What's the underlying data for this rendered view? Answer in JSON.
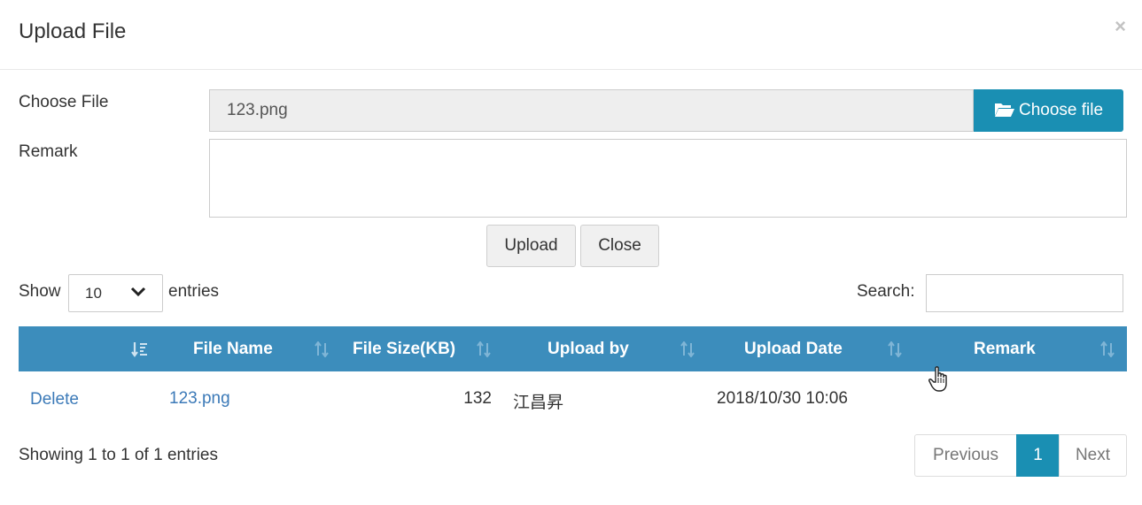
{
  "modal": {
    "title": "Upload File",
    "close_symbol": "×"
  },
  "form": {
    "choose_file_label": "Choose File",
    "file_name": "123.png",
    "choose_button": "Choose file",
    "remark_label": "Remark",
    "remark_value": "",
    "upload_button": "Upload",
    "close_button": "Close"
  },
  "table_controls": {
    "show_label": "Show",
    "entries_value": "10",
    "entries_label": "entries",
    "search_label": "Search:",
    "search_value": ""
  },
  "table": {
    "columns": [
      "",
      "File Name",
      "File Size(KB)",
      "Upload by",
      "Upload Date",
      "Remark"
    ],
    "rows": [
      {
        "action": "Delete",
        "file_name": "123.png",
        "file_size": "132",
        "upload_by": "江昌昇",
        "upload_date": "2018/10/30 10:06",
        "remark": ""
      }
    ]
  },
  "footer": {
    "info": "Showing 1 to 1 of 1 entries",
    "previous": "Previous",
    "current_page": "1",
    "next": "Next"
  },
  "colors": {
    "header_bg": "#3c8dbc",
    "primary_button": "#1a8fb3",
    "link": "#3c7ab8",
    "active_page": "#1a8fb3"
  },
  "icons": [
    "close-icon",
    "folder-open-icon",
    "chevron-down-icon",
    "sort-desc-icon",
    "sort-icon",
    "hand-cursor-icon"
  ]
}
